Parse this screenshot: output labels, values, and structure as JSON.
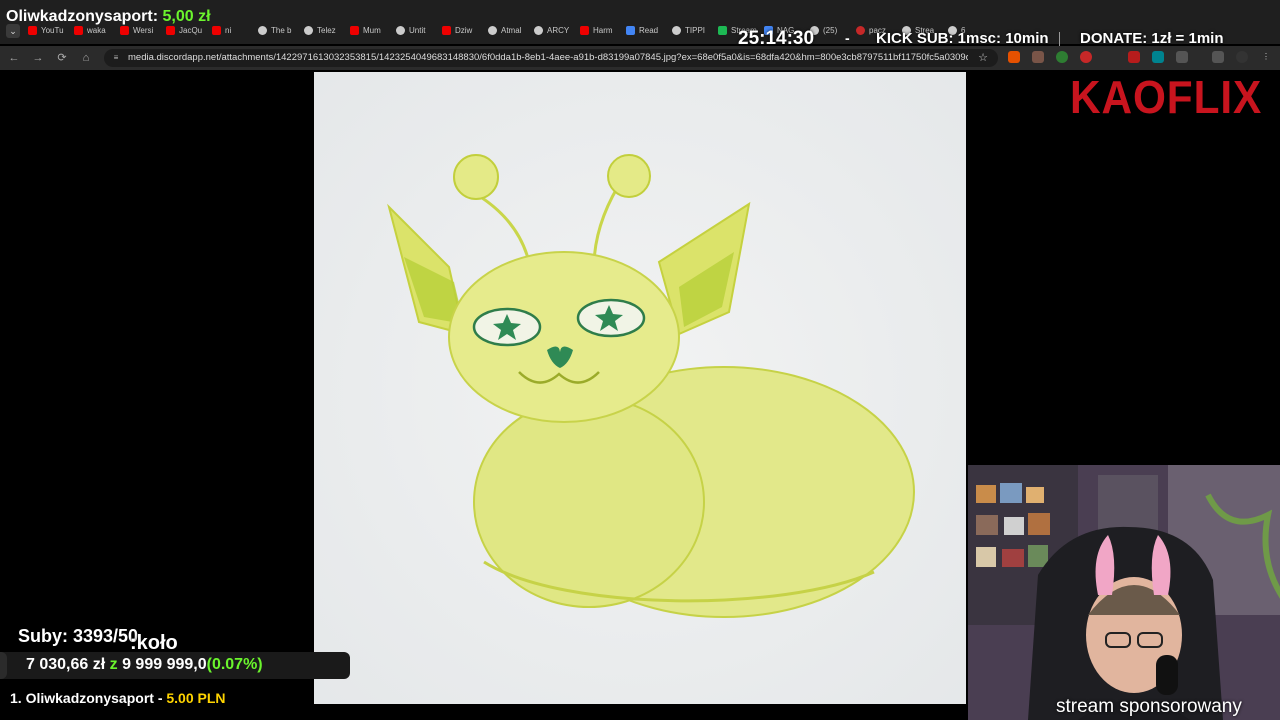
{
  "browser": {
    "tabs": [
      {
        "label": "YouTu",
        "icon": "youtube-icon"
      },
      {
        "label": "waka",
        "icon": "youtube-icon"
      },
      {
        "label": "Wersi",
        "icon": "youtube-icon"
      },
      {
        "label": "JacQu",
        "icon": "youtube-icon"
      },
      {
        "label": "ni",
        "icon": "youtube-icon"
      },
      {
        "label": "The b",
        "icon": "site-icon"
      },
      {
        "label": "Telez",
        "icon": "site-icon"
      },
      {
        "label": "Mum",
        "icon": "youtube-icon"
      },
      {
        "label": "Untit",
        "icon": "site-icon"
      },
      {
        "label": "Dziw",
        "icon": "youtube-icon"
      },
      {
        "label": "Atmal",
        "icon": "site-icon"
      },
      {
        "label": "ARCY",
        "icon": "site-icon"
      },
      {
        "label": "Harm",
        "icon": "youtube-icon"
      },
      {
        "label": "Read",
        "icon": "steam-icon"
      },
      {
        "label": "TIPPI",
        "icon": "site-icon"
      },
      {
        "label": "Stream",
        "icon": "kick-icon"
      },
      {
        "label": "NAG",
        "icon": "docs-icon"
      },
      {
        "label": "(25)",
        "icon": "tiktok-icon"
      },
      {
        "label": "pacz",
        "icon": "google-icon"
      },
      {
        "label": "Strea",
        "icon": "site-icon"
      },
      {
        "label": "6",
        "icon": "site-icon"
      }
    ],
    "url": "media.discordapp.net/attachments/1422971613032353815/1423254049683148830/6f0dda1b-8eb1-4aee-a91b-d83199a07845.jpg?ex=68e0f5a0&is=68dfa420&hm=800e3cb8797511bf11750fc5a0309da..."
  },
  "overlay": {
    "timer": "25:14:30",
    "dash": "-",
    "kick_sub": "KICK SUB: 1msc: 10min",
    "donate": "DONATE: 1zł = 1min",
    "logo": "KAOFLIX",
    "top_donor_name": "Oliwkadzonysaport:",
    "top_donor_amount": "5,00 zł",
    "subs": "Suby: 3393/50",
    "tag": ":koło",
    "goal_current": "7 030,66 zł",
    "goal_z": "z",
    "goal_target": "9 999 999,0",
    "goal_pct": "(0.07%)",
    "last_donor": "1. Oliwkadzonysaport -",
    "last_donor_amount": "5.00 PLN",
    "goal_progress": 0.0007,
    "sponsor": "stream sponsorowany"
  },
  "colors": {
    "accent_green": "#6bf52d",
    "brand_red": "#c8141e",
    "highlight_yellow": "#ffd400"
  }
}
